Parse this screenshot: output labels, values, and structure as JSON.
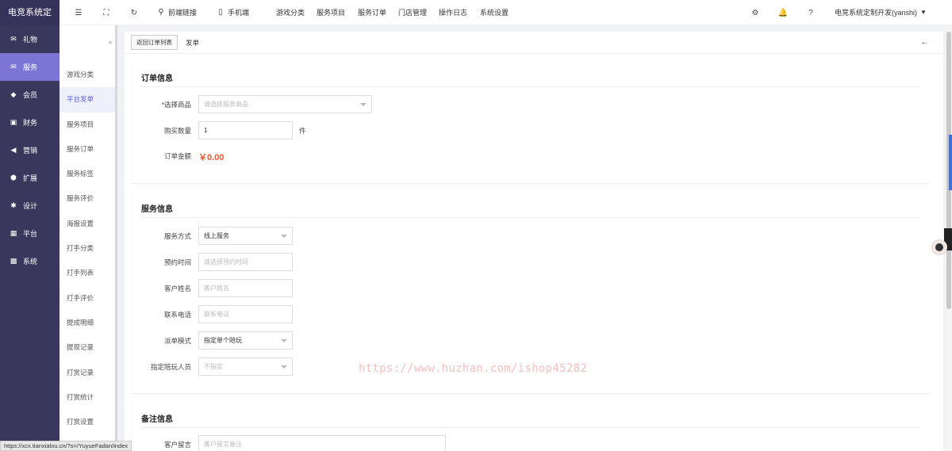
{
  "brand": "电竞系统定",
  "side_menu": [
    {
      "label": "礼物",
      "icon": "gift-icon",
      "glyph": "✉"
    },
    {
      "label": "服务",
      "icon": "service-icon",
      "glyph": "✉",
      "active": true
    },
    {
      "label": "会员",
      "icon": "member-icon",
      "glyph": "◆"
    },
    {
      "label": "财务",
      "icon": "finance-icon",
      "glyph": "▣"
    },
    {
      "label": "营销",
      "icon": "marketing-icon",
      "glyph": "◀"
    },
    {
      "label": "扩展",
      "icon": "extend-icon",
      "glyph": "⬢"
    },
    {
      "label": "设计",
      "icon": "design-icon",
      "glyph": "✱"
    },
    {
      "label": "平台",
      "icon": "platform-icon",
      "glyph": "▦"
    },
    {
      "label": "系统",
      "icon": "system-icon",
      "glyph": "▩"
    }
  ],
  "topbar": {
    "frontend_link": "前端链接",
    "mobile": "手机端",
    "nav": [
      "游戏分类",
      "服务项目",
      "服务订单",
      "门店管理",
      "操作日志",
      "系统设置"
    ],
    "user": "电竞系统定制开发(yanshi)"
  },
  "sub_menu": [
    "游戏分类",
    "平台发单",
    "服务项目",
    "服务订单",
    "服务标签",
    "服务评价",
    "海报设置",
    "打手分类",
    "打手列表",
    "打手评价",
    "提成明细",
    "提现记录",
    "打赏记录",
    "打赏统计",
    "打赏设置"
  ],
  "sub_active_index": 1,
  "breadcrumb": {
    "back": "返回订单列表",
    "current": "发单"
  },
  "order_info": {
    "title": "订单信息",
    "product_label": "*选择商品",
    "product_placeholder": "请选择服务商品",
    "qty_label": "购买数量",
    "qty_value": "1",
    "qty_unit": "件",
    "amount_label": "订单金额",
    "amount_value": "￥0.00"
  },
  "service_info": {
    "title": "服务信息",
    "mode_label": "服务方式",
    "mode_value": "线上服务",
    "time_label": "预约时间",
    "time_placeholder": "请选择预约时间",
    "name_label": "客户姓名",
    "name_placeholder": "客户姓名",
    "phone_label": "联系电话",
    "phone_placeholder": "联系电话",
    "dispatch_label": "派单模式",
    "dispatch_value": "指定单个陪玩",
    "player_label": "指定陪玩人员",
    "player_placeholder": "不指定"
  },
  "remark_info": {
    "title": "备注信息",
    "msg_label": "客户留言",
    "msg_placeholder": "客户留言备注"
  },
  "watermark": "https://www.huzhan.com/ishop45282",
  "status_url": "https://xcx.tianxialou.cn/?s=/YuyueFadan/index"
}
